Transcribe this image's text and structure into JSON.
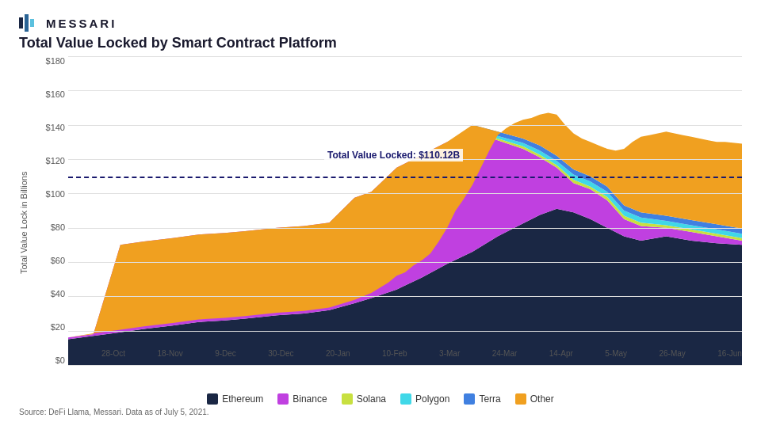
{
  "header": {
    "logo_text": "MESSARI"
  },
  "chart": {
    "title": "Total Value Locked by Smart Contract Platform",
    "y_axis_label": "Total Value Lock in Billions",
    "y_ticks": [
      "$180",
      "$160",
      "$140",
      "$120",
      "$100",
      "$80",
      "$60",
      "$40",
      "$20",
      "$0"
    ],
    "x_ticks": [
      "28-Oct",
      "18-Nov",
      "9-Dec",
      "30-Dec",
      "20-Jan",
      "10-Feb",
      "3-Mar",
      "24-Mar",
      "14-Apr",
      "5-May",
      "26-May",
      "16-Jun"
    ],
    "dashed_line_label": "Total Value Locked: $110.12B",
    "dashed_line_value": 110.12,
    "source": "Source: DeFi Llama, Messari. Data as of July 5, 2021."
  },
  "legend": {
    "items": [
      {
        "label": "Ethereum",
        "color": "#1a2744"
      },
      {
        "label": "Binance",
        "color": "#c040e0"
      },
      {
        "label": "Solana",
        "color": "#c8e040"
      },
      {
        "label": "Polygon",
        "color": "#40d8e8"
      },
      {
        "label": "Terra",
        "color": "#4080e0"
      },
      {
        "label": "Other",
        "color": "#f0a020"
      }
    ]
  }
}
